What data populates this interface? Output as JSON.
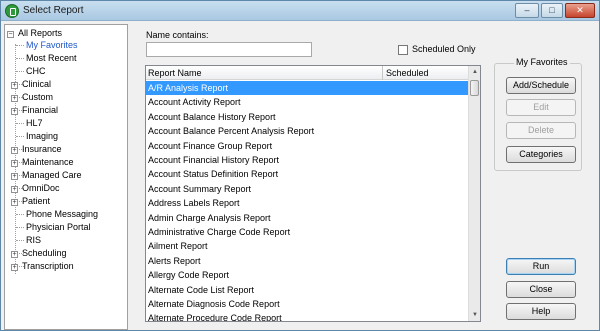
{
  "window": {
    "title": "Select Report"
  },
  "tree": {
    "root": "All Reports",
    "items": [
      {
        "label": "My Favorites",
        "expandable": false,
        "selected": true
      },
      {
        "label": "Most Recent",
        "expandable": false
      },
      {
        "label": "CHC",
        "expandable": false
      },
      {
        "label": "Clinical",
        "expandable": true
      },
      {
        "label": "Custom",
        "expandable": true
      },
      {
        "label": "Financial",
        "expandable": true
      },
      {
        "label": "HL7",
        "expandable": false
      },
      {
        "label": "Imaging",
        "expandable": false
      },
      {
        "label": "Insurance",
        "expandable": true
      },
      {
        "label": "Maintenance",
        "expandable": true
      },
      {
        "label": "Managed Care",
        "expandable": true
      },
      {
        "label": "OmniDoc",
        "expandable": true
      },
      {
        "label": "Patient",
        "expandable": true
      },
      {
        "label": "Phone Messaging",
        "expandable": false
      },
      {
        "label": "Physician Portal",
        "expandable": false
      },
      {
        "label": "RIS",
        "expandable": false
      },
      {
        "label": "Scheduling",
        "expandable": true
      },
      {
        "label": "Transcription",
        "expandable": true
      }
    ]
  },
  "filter": {
    "name_label": "Name contains:",
    "name_value": "",
    "scheduled_only_label": "Scheduled Only"
  },
  "list": {
    "columns": [
      "Report Name",
      "Scheduled"
    ],
    "rows": [
      "A/R Analysis Report",
      "Account Activity Report",
      "Account Balance History Report",
      "Account Balance Percent Analysis Report",
      "Account Finance Group Report",
      "Account Financial History Report",
      "Account Status Definition Report",
      "Account Summary Report",
      "Address Labels Report",
      "Admin Charge Analysis Report",
      "Administrative Charge Code Report",
      "Ailment Report",
      "Alerts Report",
      "Allergy Code Report",
      "Alternate Code List Report",
      "Alternate Diagnosis Code Report",
      "Alternate Procedure Code Report"
    ]
  },
  "favorites": {
    "legend": "My Favorites",
    "add_schedule": "Add/Schedule",
    "edit": "Edit",
    "delete": "Delete",
    "categories": "Categories"
  },
  "actions": {
    "run": "Run",
    "close": "Close",
    "help": "Help"
  },
  "colors": {
    "selection": "#3399ff",
    "favorites_link": "#1f58c8"
  }
}
